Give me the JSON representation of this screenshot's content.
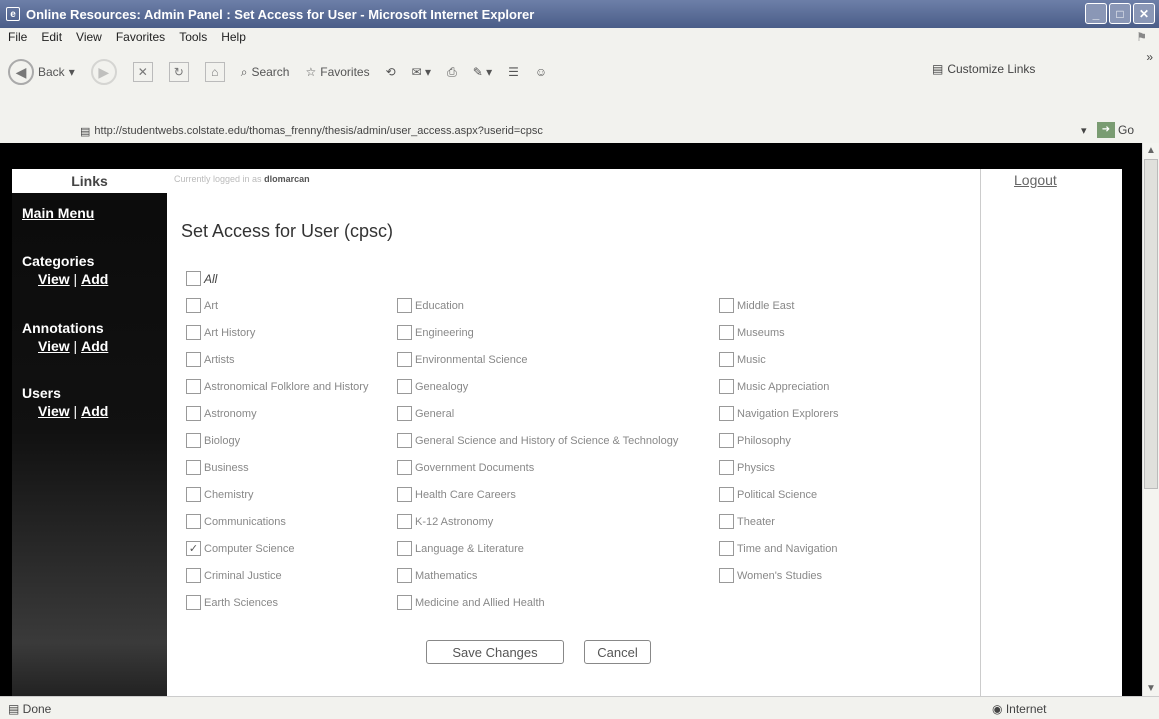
{
  "window": {
    "title": "Online Resources: Admin Panel : Set Access for User - Microsoft Internet Explorer",
    "controls": [
      "_",
      "□",
      "✕"
    ]
  },
  "menu": [
    "File",
    "Edit",
    "View",
    "Favorites",
    "Tools",
    "Help"
  ],
  "toolbar": {
    "back": "Back",
    "search": "Search",
    "favorites": "Favorites",
    "customize_links": "Customize Links"
  },
  "address": {
    "url": "http://studentwebs.colstate.edu/thomas_frenny/thesis/admin/user_access.aspx?userid=cpsc",
    "go": "Go"
  },
  "sidebar": {
    "header": "Links",
    "main_menu": "Main Menu",
    "categories": "Categories",
    "annotations": "Annotations",
    "users": "Users",
    "view": "View",
    "sep": "|",
    "add": "Add"
  },
  "header": {
    "logged_in_prefix": "Currently logged in as",
    "username": "dlomarcan",
    "logout": "Logout"
  },
  "page": {
    "title": "Set Access for User (cpsc)",
    "all_label": "All",
    "col1": [
      {
        "label": "Art",
        "checked": false
      },
      {
        "label": "Art History",
        "checked": false
      },
      {
        "label": "Artists",
        "checked": false
      },
      {
        "label": "Astronomical Folklore and History",
        "checked": false
      },
      {
        "label": "Astronomy",
        "checked": false
      },
      {
        "label": "Biology",
        "checked": false
      },
      {
        "label": "Business",
        "checked": false
      },
      {
        "label": "Chemistry",
        "checked": false
      },
      {
        "label": "Communications",
        "checked": false
      },
      {
        "label": "Computer Science",
        "checked": true
      },
      {
        "label": "Criminal Justice",
        "checked": false
      },
      {
        "label": "Earth Sciences",
        "checked": false
      }
    ],
    "col2": [
      {
        "label": "Education",
        "checked": false
      },
      {
        "label": "Engineering",
        "checked": false
      },
      {
        "label": "Environmental Science",
        "checked": false
      },
      {
        "label": "Genealogy",
        "checked": false
      },
      {
        "label": "General",
        "checked": false
      },
      {
        "label": "General Science and History of Science & Technology",
        "checked": false
      },
      {
        "label": "Government Documents",
        "checked": false
      },
      {
        "label": "Health Care Careers",
        "checked": false
      },
      {
        "label": "K-12 Astronomy",
        "checked": false
      },
      {
        "label": "Language & Literature",
        "checked": false
      },
      {
        "label": "Mathematics",
        "checked": false
      },
      {
        "label": "Medicine and Allied Health",
        "checked": false
      }
    ],
    "col3": [
      {
        "label": "Middle East",
        "checked": false
      },
      {
        "label": "Museums",
        "checked": false
      },
      {
        "label": "Music",
        "checked": false
      },
      {
        "label": "Music Appreciation",
        "checked": false
      },
      {
        "label": "Navigation Explorers",
        "checked": false
      },
      {
        "label": "Philosophy",
        "checked": false
      },
      {
        "label": "Physics",
        "checked": false
      },
      {
        "label": "Political Science",
        "checked": false
      },
      {
        "label": "Theater",
        "checked": false
      },
      {
        "label": "Time and Navigation",
        "checked": false
      },
      {
        "label": "Women's Studies",
        "checked": false
      }
    ],
    "save": "Save Changes",
    "cancel": "Cancel"
  },
  "status": {
    "left": "Done",
    "zone": "Internet"
  }
}
